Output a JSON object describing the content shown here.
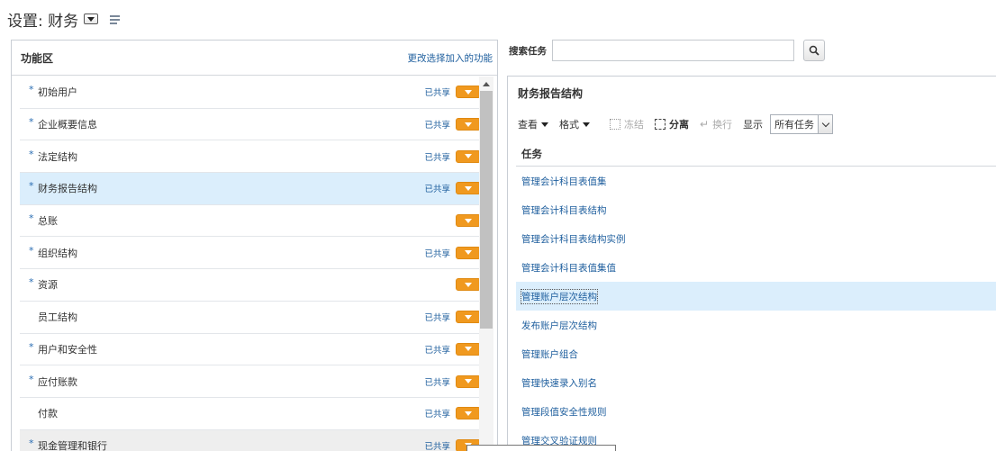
{
  "header": {
    "title": "设置: 财务"
  },
  "functional_area": {
    "title": "功能区",
    "change_link": "更改选择加入的功能",
    "items": [
      {
        "star": "*",
        "label": "初始用户",
        "shared": "已共享"
      },
      {
        "star": "*",
        "label": "企业概要信息",
        "shared": "已共享"
      },
      {
        "star": "*",
        "label": "法定结构",
        "shared": "已共享"
      },
      {
        "star": "*",
        "label": "财务报告结构",
        "shared": "已共享"
      },
      {
        "star": "*",
        "label": "总账",
        "shared": ""
      },
      {
        "star": "*",
        "label": "组织结构",
        "shared": "已共享"
      },
      {
        "star": "*",
        "label": "资源",
        "shared": ""
      },
      {
        "star": "",
        "label": "员工结构",
        "shared": "已共享"
      },
      {
        "star": "*",
        "label": "用户和安全性",
        "shared": "已共享"
      },
      {
        "star": "*",
        "label": "应付账款",
        "shared": "已共享"
      },
      {
        "star": "",
        "label": "付款",
        "shared": "已共享"
      },
      {
        "star": "*",
        "label": "现金管理和银行",
        "shared": "已共享"
      }
    ]
  },
  "search": {
    "label": "搜索任务",
    "value": ""
  },
  "detail": {
    "title": "财务报告结构",
    "toolbar": {
      "view": "查看",
      "format": "格式",
      "freeze": "冻结",
      "detach": "分离",
      "wrap": "换行",
      "show_label": "显示",
      "show_value": "所有任务"
    },
    "column_header": "任务",
    "tasks": [
      "管理会计科目表值集",
      "管理会计科目表结构",
      "管理会计科目表结构实例",
      "管理会计科目表值集值",
      "管理账户层次结构",
      "发布账户层次结构",
      "管理账户组合",
      "管理快速录入别名",
      "管理段值安全性规则",
      "管理交叉验证规则"
    ]
  },
  "colors": {
    "link": "#1f5f9e",
    "selected_row": "#dbeefc",
    "orange_button": "#f0991f"
  }
}
